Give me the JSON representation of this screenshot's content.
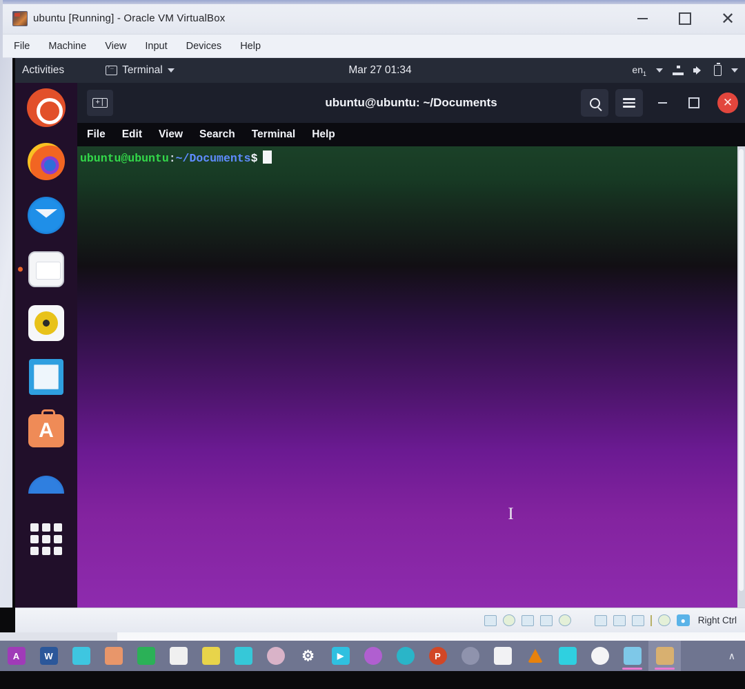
{
  "host_window": {
    "title": "ubuntu [Running] - Oracle VM VirtualBox",
    "app_icon": "virtualbox-icon",
    "menus": [
      "File",
      "Machine",
      "View",
      "Input",
      "Devices",
      "Help"
    ],
    "controls": {
      "minimize": "minimize-icon",
      "maximize": "maximize-icon",
      "close": "✕"
    }
  },
  "guest": {
    "topbar": {
      "activities": "Activities",
      "app_menu": "Terminal",
      "app_menu_caret": "chevron-down-icon",
      "clock": "Mar 27 01:34",
      "keyboard_layout": "en",
      "keyboard_layout_sub": "1",
      "status_icons": [
        "network-icon",
        "volume-icon",
        "battery-icon",
        "chevron-down-icon"
      ]
    },
    "dock": {
      "items": [
        {
          "name": "ubuntu-logo",
          "label": "Ubuntu",
          "running": false
        },
        {
          "name": "firefox",
          "label": "Firefox Web Browser",
          "running": false
        },
        {
          "name": "thunderbird",
          "label": "Thunderbird Mail",
          "running": false
        },
        {
          "name": "files",
          "label": "Files",
          "running": true
        },
        {
          "name": "rhythmbox",
          "label": "Rhythmbox",
          "running": false
        },
        {
          "name": "libreoffice-writer",
          "label": "LibreOffice Writer",
          "running": false
        },
        {
          "name": "ubuntu-software",
          "label": "Ubuntu Software",
          "running": false,
          "glyph": "A"
        },
        {
          "name": "help",
          "label": "Help",
          "running": false
        }
      ],
      "show_applications": "Show Applications"
    },
    "terminal": {
      "title": "ubuntu@ubuntu: ~/Documents",
      "new_tab": "new-tab-button",
      "new_tab_glyph": "+|",
      "header_buttons": [
        "search-icon",
        "hamburger-menu-icon",
        "minimize-icon",
        "maximize-icon",
        "close-icon"
      ],
      "close_glyph": "✕",
      "menus": [
        "File",
        "Edit",
        "View",
        "Search",
        "Terminal",
        "Help"
      ],
      "prompt": {
        "user_host": "ubuntu@ubuntu",
        "colon": ":",
        "path": "~/Documents",
        "sigil": "$",
        "input": ""
      },
      "cursor": "block-cursor",
      "mouse_pointer": "i-beam-pointer",
      "colors": {
        "prompt_user": "#33d94a",
        "prompt_path": "#5f8cff",
        "bg_top": "#1b4128",
        "bg_bottom": "#8e2bae"
      }
    }
  },
  "vbox_statusbar": {
    "device_icons": [
      "hard-disk-icon",
      "optical-disk-icon",
      "floppy-icon",
      "network-adapter-icon",
      "usb-icon",
      "shared-folder-icon",
      "display-icon",
      "recording-icon",
      "mouse-icon",
      "keyboard-icon"
    ],
    "host_key_icon": "host-key-icon",
    "host_key_label": "Right Ctrl"
  },
  "windows_taskbar": {
    "items": [
      {
        "name": "taskbar-item-access",
        "glyph": "A",
        "color": "#a03bb8"
      },
      {
        "name": "taskbar-item-word",
        "glyph": "W",
        "color": "#2b579a"
      },
      {
        "name": "taskbar-item-notepad-blue",
        "glyph": "",
        "color": "#3ec6e0"
      },
      {
        "name": "taskbar-item-orange-app",
        "glyph": "",
        "color": "#e8966a"
      },
      {
        "name": "taskbar-item-excel",
        "glyph": "",
        "color": "#2bb157"
      },
      {
        "name": "taskbar-item-notes",
        "glyph": "",
        "color": "#f0f0f0"
      },
      {
        "name": "taskbar-item-sticky-notes",
        "glyph": "",
        "color": "#e8d44a"
      },
      {
        "name": "taskbar-item-teal-app",
        "glyph": "",
        "color": "#36c8d8"
      },
      {
        "name": "taskbar-item-paint",
        "glyph": "",
        "color": "#d9b3c8"
      },
      {
        "name": "taskbar-item-settings",
        "glyph": "⚙",
        "color": "#6f7590"
      },
      {
        "name": "taskbar-item-media-player",
        "glyph": "▶",
        "color": "#2fc0e0"
      },
      {
        "name": "taskbar-item-photo-app",
        "glyph": "",
        "color": "#b05fd0"
      },
      {
        "name": "taskbar-item-edge",
        "glyph": "",
        "color": "#2ab5c8"
      },
      {
        "name": "taskbar-item-powerpoint",
        "glyph": "P",
        "color": "#d24726"
      },
      {
        "name": "taskbar-item-onedrive-sync",
        "glyph": "",
        "color": "#8f93ad"
      },
      {
        "name": "taskbar-item-contacts",
        "glyph": "",
        "color": "#f2f2f4"
      },
      {
        "name": "taskbar-item-vlc",
        "glyph": "",
        "color": "#e8820c"
      },
      {
        "name": "taskbar-item-cloud",
        "glyph": "",
        "color": "#2fd0e0"
      },
      {
        "name": "taskbar-item-xbox",
        "glyph": "",
        "color": "#f4f4f6"
      },
      {
        "name": "taskbar-item-virtualbox",
        "glyph": "",
        "color": "#7ec8e8",
        "running": true
      },
      {
        "name": "taskbar-item-active-window",
        "glyph": "",
        "color": "#d8b070",
        "active": true
      }
    ],
    "tray": "∧"
  }
}
